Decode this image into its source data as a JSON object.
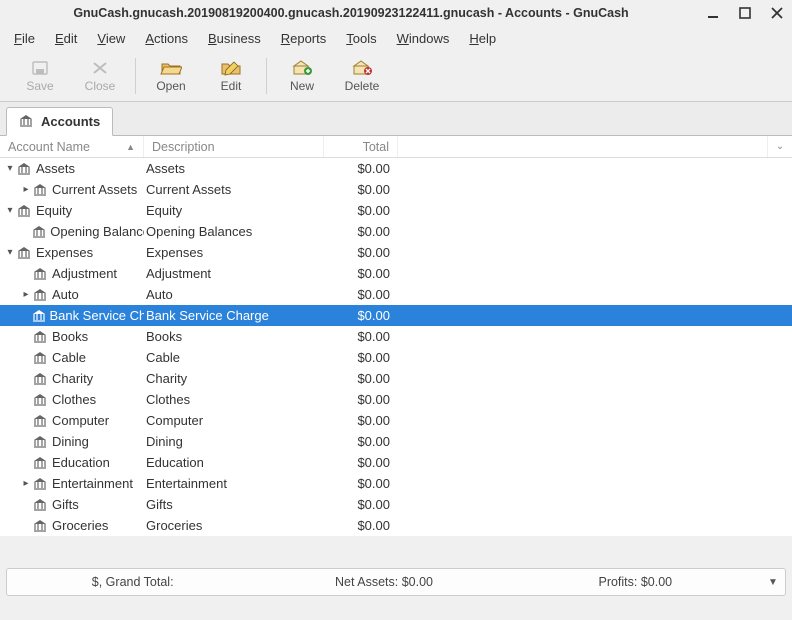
{
  "window": {
    "title": "GnuCash.gnucash.20190819200400.gnucash.20190923122411.gnucash - Accounts - GnuCash"
  },
  "menu": {
    "file": "File",
    "edit": "Edit",
    "view": "View",
    "actions": "Actions",
    "business": "Business",
    "reports": "Reports",
    "tools": "Tools",
    "windows": "Windows",
    "help": "Help"
  },
  "toolbar": {
    "save": "Save",
    "close": "Close",
    "open": "Open",
    "edit": "Edit",
    "new": "New",
    "delete": "Delete"
  },
  "tabs": {
    "accounts": "Accounts"
  },
  "columns": {
    "name": "Account Name",
    "description": "Description",
    "total": "Total"
  },
  "tree": [
    {
      "indent": 0,
      "expander": "down",
      "name": "Assets",
      "desc": "Assets",
      "total": "$0.00",
      "selected": false
    },
    {
      "indent": 1,
      "expander": "right",
      "name": "Current Assets",
      "desc": "Current Assets",
      "total": "$0.00",
      "selected": false
    },
    {
      "indent": 0,
      "expander": "down",
      "name": "Equity",
      "desc": "Equity",
      "total": "$0.00",
      "selected": false
    },
    {
      "indent": 1,
      "expander": "none",
      "name": "Opening Balance",
      "desc": "Opening Balances",
      "total": "$0.00",
      "selected": false
    },
    {
      "indent": 0,
      "expander": "down",
      "name": "Expenses",
      "desc": "Expenses",
      "total": "$0.00",
      "selected": false
    },
    {
      "indent": 1,
      "expander": "none",
      "name": "Adjustment",
      "desc": "Adjustment",
      "total": "$0.00",
      "selected": false
    },
    {
      "indent": 1,
      "expander": "right",
      "name": "Auto",
      "desc": "Auto",
      "total": "$0.00",
      "selected": false
    },
    {
      "indent": 1,
      "expander": "none",
      "name": "Bank Service Cha",
      "desc": "Bank Service Charge",
      "total": "$0.00",
      "selected": true
    },
    {
      "indent": 1,
      "expander": "none",
      "name": "Books",
      "desc": "Books",
      "total": "$0.00",
      "selected": false
    },
    {
      "indent": 1,
      "expander": "none",
      "name": "Cable",
      "desc": "Cable",
      "total": "$0.00",
      "selected": false
    },
    {
      "indent": 1,
      "expander": "none",
      "name": "Charity",
      "desc": "Charity",
      "total": "$0.00",
      "selected": false
    },
    {
      "indent": 1,
      "expander": "none",
      "name": "Clothes",
      "desc": "Clothes",
      "total": "$0.00",
      "selected": false
    },
    {
      "indent": 1,
      "expander": "none",
      "name": "Computer",
      "desc": "Computer",
      "total": "$0.00",
      "selected": false
    },
    {
      "indent": 1,
      "expander": "none",
      "name": "Dining",
      "desc": "Dining",
      "total": "$0.00",
      "selected": false
    },
    {
      "indent": 1,
      "expander": "none",
      "name": "Education",
      "desc": "Education",
      "total": "$0.00",
      "selected": false
    },
    {
      "indent": 1,
      "expander": "right",
      "name": "Entertainment",
      "desc": "Entertainment",
      "total": "$0.00",
      "selected": false
    },
    {
      "indent": 1,
      "expander": "none",
      "name": "Gifts",
      "desc": "Gifts",
      "total": "$0.00",
      "selected": false
    },
    {
      "indent": 1,
      "expander": "none",
      "name": "Groceries",
      "desc": "Groceries",
      "total": "$0.00",
      "selected": false
    }
  ],
  "summary": {
    "grand_total": "$, Grand Total:",
    "net_assets": "Net Assets: $0.00",
    "profits": "Profits: $0.00"
  }
}
